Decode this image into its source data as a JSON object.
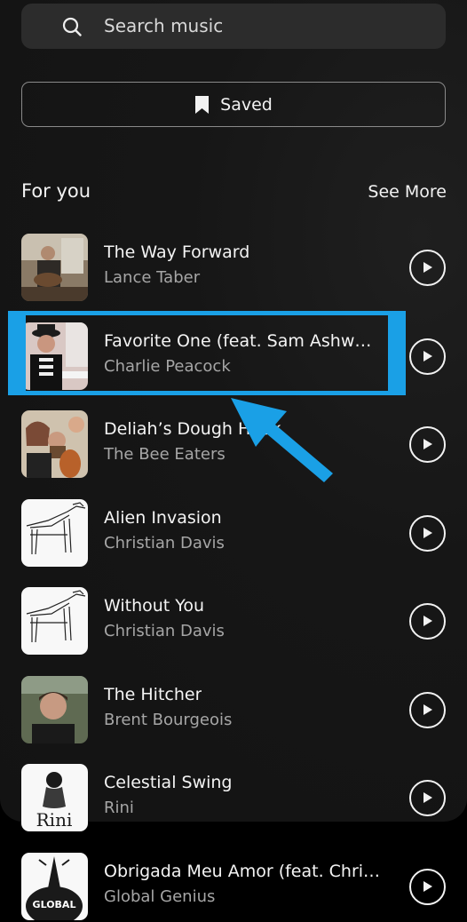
{
  "search": {
    "placeholder": "Search music",
    "icon": "search-icon"
  },
  "saved_button": {
    "label": "Saved",
    "icon": "bookmark-icon"
  },
  "section": {
    "title": "For you",
    "see_more": "See More"
  },
  "tracks": [
    {
      "title": "The Way Forward",
      "artist": "Lance Taber",
      "art": "photo-guitarist"
    },
    {
      "title": "Favorite One (feat. Sam Ashw…",
      "artist": "Charlie Peacock",
      "art": "photo-man-hat"
    },
    {
      "title": "Deliah’s Dough Hook",
      "artist": "The Bee Eaters",
      "art": "photo-trio"
    },
    {
      "title": "Alien Invasion",
      "artist": "Christian Davis",
      "art": "sketch-dog"
    },
    {
      "title": "Without You",
      "artist": "Christian Davis",
      "art": "sketch-dog"
    },
    {
      "title": "The Hitcher",
      "artist": "Brent Bourgeois",
      "art": "photo-man"
    },
    {
      "title": "Celestial Swing",
      "artist": "Rini",
      "art": "rini-logo"
    },
    {
      "title": "Obrigada Meu Amor (feat. Chri…",
      "artist": "Global Genius",
      "art": "global-genius-logo"
    }
  ],
  "annotation": {
    "highlighted_index": 1,
    "color": "#1aa0e6"
  },
  "colors": {
    "background": "#141414",
    "accent": "#1aa0e6"
  },
  "rini_logo_text": "Rini",
  "global_logo_text": "GLOBAL"
}
